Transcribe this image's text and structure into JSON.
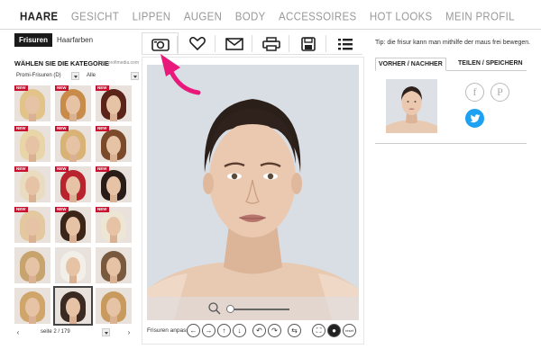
{
  "nav": {
    "items": [
      "HAARE",
      "GESICHT",
      "LIPPEN",
      "AUGEN",
      "BODY",
      "ACCESSOIRES",
      "HOT LOOKS",
      "MEIN PROFIL"
    ],
    "active_index": 0
  },
  "subtabs": {
    "active": "Frisuren",
    "inactive": "Haarfarben"
  },
  "category": {
    "title": "WÄHLEN SIE DIE KATEGORIE",
    "credit": "foto: profimedia.com",
    "filter1": "Promi-Frisuren (D)",
    "filter2": "Alle"
  },
  "thumbnails": [
    {
      "new": true,
      "hair": "#e2c48a"
    },
    {
      "new": true,
      "hair": "#c98b4a"
    },
    {
      "new": true,
      "hair": "#5a2418"
    },
    {
      "new": true,
      "hair": "#e8d6a8"
    },
    {
      "new": true,
      "hair": "#d9b276"
    },
    {
      "new": true,
      "hair": "#7a4a2a"
    },
    {
      "new": true,
      "hair": "#e9dcc0"
    },
    {
      "new": true,
      "hair": "#b8232d"
    },
    {
      "new": true,
      "hair": "#2a1d17"
    },
    {
      "new": true,
      "hair": "#e4c9a0"
    },
    {
      "new": true,
      "hair": "#3b2518"
    },
    {
      "new": true,
      "hair": "#eee6d4"
    },
    {
      "new": false,
      "hair": "#c7a36d"
    },
    {
      "new": false,
      "hair": "#f2efe8"
    },
    {
      "new": false,
      "hair": "#7a5a3e"
    },
    {
      "new": false,
      "hair": "#cfa56a"
    },
    {
      "new": false,
      "hair": "#3a2a22",
      "selected": true
    },
    {
      "new": false,
      "hair": "#c99a5e"
    }
  ],
  "new_badge": "NEW",
  "pager": {
    "label": "seite 2 / 179",
    "prev": "‹",
    "next": "›"
  },
  "toolbar": {
    "buttons": [
      {
        "name": "camera-button",
        "icon": "camera-icon"
      },
      {
        "name": "favorite-button",
        "icon": "heart-icon"
      },
      {
        "name": "mail-button",
        "icon": "mail-icon"
      },
      {
        "name": "print-button",
        "icon": "printer-icon"
      },
      {
        "name": "save-button",
        "icon": "floppy-disk-icon"
      },
      {
        "name": "list-button",
        "icon": "list-icon"
      }
    ]
  },
  "editor": {
    "zoom_level": 0.05,
    "adjust_label": "Frisuren anpassen",
    "controls": [
      "←",
      "→",
      "↑",
      "↓",
      "↶",
      "↷",
      "⇆",
      "⛶",
      "●",
      "reset"
    ]
  },
  "right": {
    "tip": "Tip: die frisur kann man mithilfe der maus frei bewegen.",
    "tab_active": "VORHER / NACHHER",
    "tab_inactive": "TEILEN / SPEICHERN",
    "social": [
      "facebook-icon",
      "pinterest-icon",
      "twitter-icon"
    ]
  },
  "colors": {
    "accent_pink": "#e8197a",
    "new_badge": "#c8102e",
    "twitter": "#1da1f2"
  }
}
